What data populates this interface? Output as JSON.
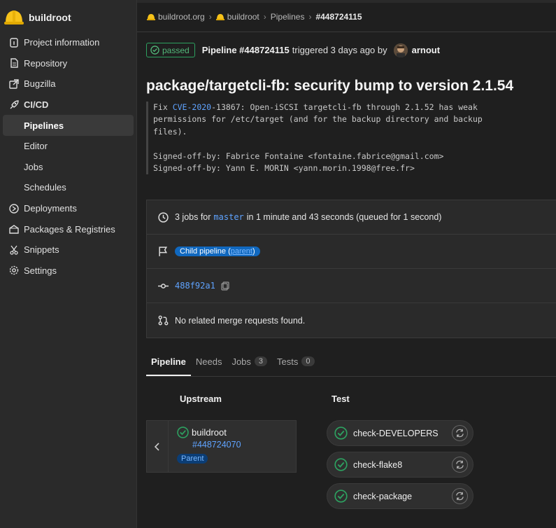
{
  "project": {
    "name": "buildroot",
    "icon": "helmet-icon"
  },
  "sidebar": {
    "items": [
      {
        "label": "Project information",
        "icon": "info-icon",
        "type": "item"
      },
      {
        "label": "Repository",
        "icon": "document-icon",
        "type": "item"
      },
      {
        "label": "Bugzilla",
        "icon": "external-link-icon",
        "type": "item"
      },
      {
        "label": "CI/CD",
        "icon": "rocket-icon",
        "type": "section"
      },
      {
        "label": "Pipelines",
        "type": "sub-active"
      },
      {
        "label": "Editor",
        "type": "sub"
      },
      {
        "label": "Jobs",
        "type": "sub"
      },
      {
        "label": "Schedules",
        "type": "sub"
      },
      {
        "label": "Deployments",
        "icon": "deployments-icon",
        "type": "item"
      },
      {
        "label": "Packages & Registries",
        "icon": "package-icon",
        "type": "item"
      },
      {
        "label": "Snippets",
        "icon": "snippet-icon",
        "type": "item"
      },
      {
        "label": "Settings",
        "icon": "gear-icon",
        "type": "item"
      }
    ]
  },
  "breadcrumb": {
    "group": "buildroot.org",
    "project": "buildroot",
    "section": "Pipelines",
    "current": "#448724115"
  },
  "pipeline": {
    "status": "passed",
    "id_label": "Pipeline #448724115",
    "triggered_text": "triggered 3 days ago by",
    "author": "arnout",
    "title": "package/targetcli-fb: security bump to version 2.1.54",
    "commit": {
      "line1_prefix": "Fix ",
      "cve_link": "CVE-2020",
      "line1_suffix": "-13867: Open-iSCSI targetcli-fb through 2.1.52 has weak",
      "line2": "permissions for /etc/target (and for the backup directory and backup",
      "line3": "files).",
      "signed1": "Signed-off-by: Fabrice Fontaine <fontaine.fabrice@gmail.com>",
      "signed2": "Signed-off-by: Yann E. MORIN <yann.morin.1998@free.fr>"
    },
    "jobs_summary": {
      "prefix": "3 jobs for",
      "branch": "master",
      "suffix": "in 1 minute and 43 seconds (queued for 1 second)"
    },
    "child_pill": {
      "text": "Child pipeline (",
      "parent": "parent",
      "close": ")"
    },
    "sha": "488f92a1",
    "merge_requests": "No related merge requests found."
  },
  "tabs": [
    {
      "label": "Pipeline",
      "count": null,
      "active": true
    },
    {
      "label": "Needs",
      "count": null,
      "active": false
    },
    {
      "label": "Jobs",
      "count": "3",
      "active": false
    },
    {
      "label": "Tests",
      "count": "0",
      "active": false
    }
  ],
  "graph": {
    "upstream_heading": "Upstream",
    "test_heading": "Test",
    "upstream": {
      "name": "buildroot",
      "id": "#448724070",
      "badge": "Parent"
    },
    "jobs": [
      {
        "name": "check-DEVELOPERS"
      },
      {
        "name": "check-flake8"
      },
      {
        "name": "check-package"
      }
    ]
  },
  "colors": {
    "success": "#2da160",
    "link": "#5fa3ff",
    "pill": "#1068bf"
  }
}
